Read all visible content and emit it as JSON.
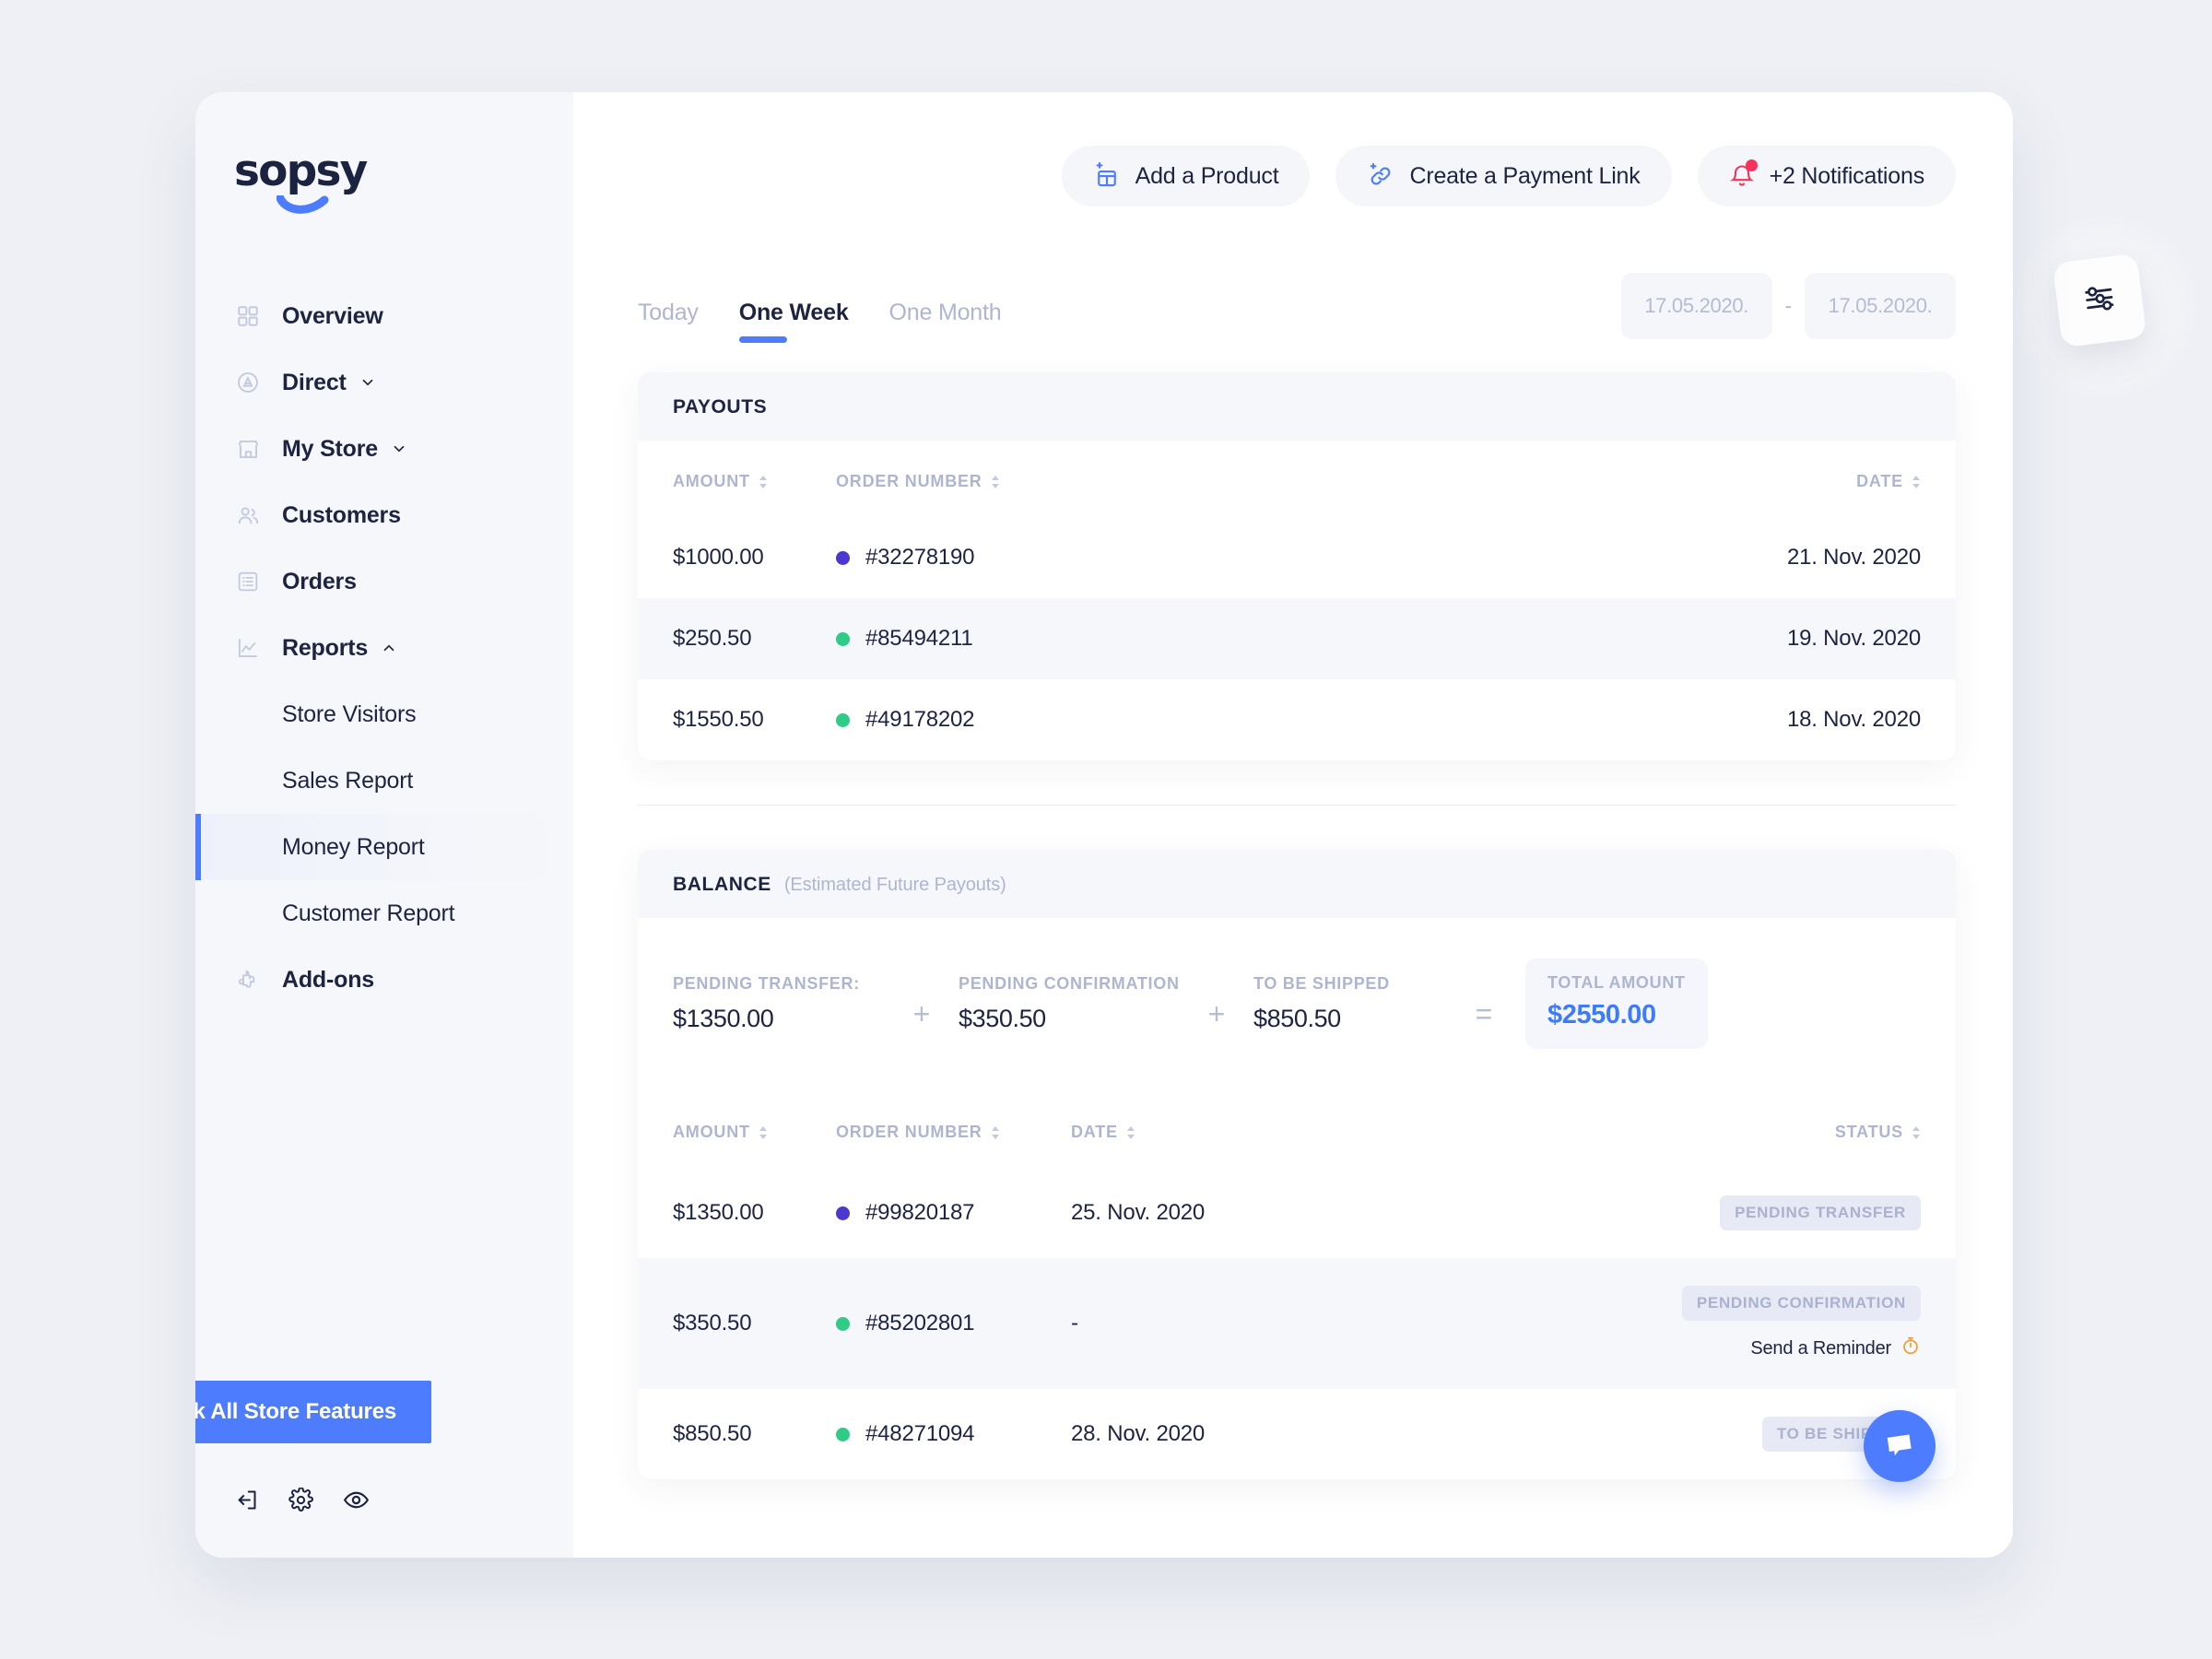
{
  "brand": {
    "name": "sopsy",
    "accent": "#4d7cfe",
    "logo_mark": "smile-underline"
  },
  "topbar": {
    "actions": [
      {
        "label": "Add a Product",
        "icon": "add-product-icon"
      },
      {
        "label": "Create a Payment Link",
        "icon": "add-link-icon"
      },
      {
        "label": "+2 Notifications",
        "icon": "bell-icon",
        "badge": true
      }
    ]
  },
  "sidebar": {
    "items": [
      {
        "label": "Overview",
        "icon": "grid-icon",
        "caret": null
      },
      {
        "label": "Direct",
        "icon": "direct-circle-icon",
        "caret": "down"
      },
      {
        "label": "My Store",
        "icon": "store-icon",
        "caret": "down"
      },
      {
        "label": "Customers",
        "icon": "customers-icon",
        "caret": null
      },
      {
        "label": "Orders",
        "icon": "orders-list-icon",
        "caret": null
      },
      {
        "label": "Reports",
        "icon": "chart-line-icon",
        "caret": "up"
      }
    ],
    "sub_items": [
      {
        "label": "Store Visitors",
        "active": false
      },
      {
        "label": "Sales Report",
        "active": false
      },
      {
        "label": "Money Report",
        "active": true
      },
      {
        "label": "Customer Report",
        "active": false
      }
    ],
    "addons": {
      "label": "Add-ons",
      "icon": "puzzle-icon"
    },
    "unlock_button": "Unlock All Store Features",
    "footer_icons": [
      "logout-icon",
      "gear-icon",
      "eye-icon"
    ]
  },
  "filters": {
    "tabs": [
      {
        "label": "Today",
        "active": false
      },
      {
        "label": "One Week",
        "active": true
      },
      {
        "label": "One Month",
        "active": false
      }
    ],
    "date_from": "17.05.2020.",
    "date_to": "17.05.2020.",
    "date_separator": "-"
  },
  "payouts": {
    "title": "PAYOUTS",
    "columns": [
      "AMOUNT",
      "ORDER NUMBER",
      "DATE"
    ],
    "rows": [
      {
        "amount": "$1000.00",
        "order": "#32278190",
        "date": "21. Nov. 2020",
        "dot": "#4b38d0"
      },
      {
        "amount": "$250.50",
        "order": "#85494211",
        "date": "19. Nov. 2020",
        "dot": "#2ecc87"
      },
      {
        "amount": "$1550.50",
        "order": "#49178202",
        "date": "18. Nov. 2020",
        "dot": "#2ecc87"
      }
    ]
  },
  "balance": {
    "title": "BALANCE",
    "subtitle": "(Estimated Future Payouts)",
    "summary": [
      {
        "label": "PENDING TRANSFER:",
        "value": "$1350.00"
      },
      {
        "label": "PENDING CONFIRMATION",
        "value": "$350.50"
      },
      {
        "label": "TO BE SHIPPED",
        "value": "$850.50"
      }
    ],
    "operators": [
      "+",
      "+",
      "="
    ],
    "total": {
      "label": "TOTAL AMOUNT",
      "value": "$2550.00"
    },
    "columns": [
      "AMOUNT",
      "ORDER NUMBER",
      "DATE",
      "STATUS"
    ],
    "rows": [
      {
        "amount": "$1350.00",
        "order": "#99820187",
        "date": "25. Nov. 2020",
        "status": "PENDING TRANSFER",
        "dot": "#4b38d0",
        "reminder": null
      },
      {
        "amount": "$350.50",
        "order": "#85202801",
        "date": "-",
        "status": "PENDING CONFIRMATION",
        "dot": "#2ecc87",
        "reminder": "Send a Reminder"
      },
      {
        "amount": "$850.50",
        "order": "#48271094",
        "date": "28. Nov. 2020",
        "status": "TO BE SHIPPED",
        "dot": "#2ecc87",
        "reminder": null
      }
    ]
  },
  "floating": {
    "card_icon": "sliders-icon",
    "chat_icon": "chat-bubble-icon"
  }
}
